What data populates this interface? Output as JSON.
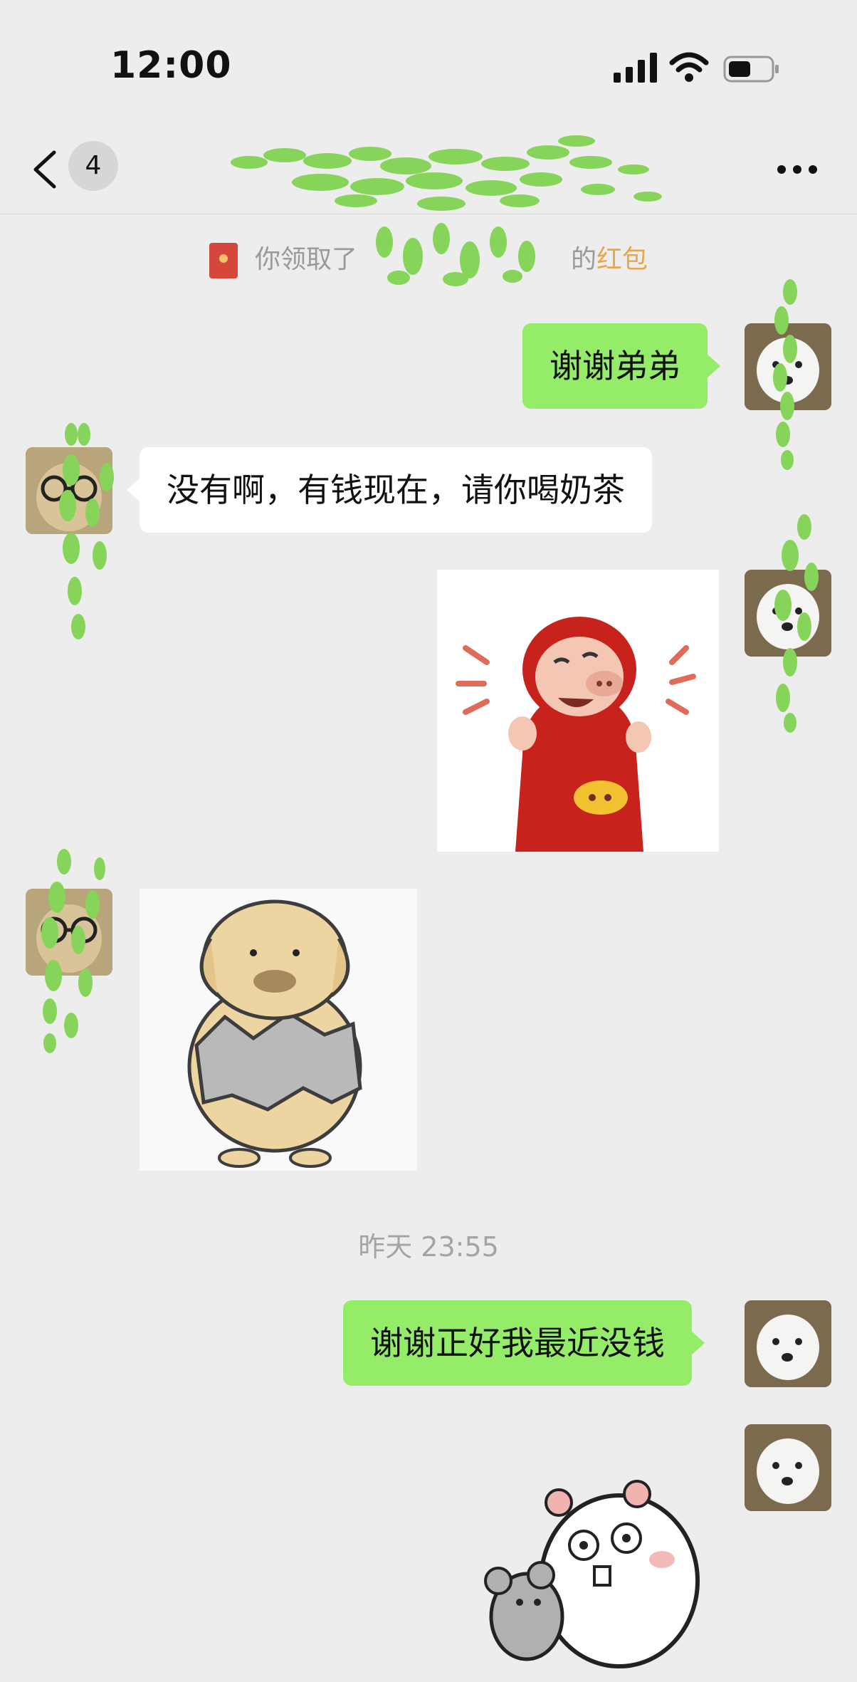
{
  "status_bar": {
    "time": "12:00"
  },
  "nav": {
    "unread_count": "4",
    "title": ""
  },
  "notice": {
    "prefix": "你领取了",
    "suffix": "的",
    "link": "红包"
  },
  "messages": {
    "m1": "谢谢弟弟",
    "m2": "没有啊，有钱现在，请你喝奶茶",
    "m3": "谢谢正好我最近没钱"
  },
  "timestamp": "昨天 23:55",
  "colors": {
    "accent_green": "#95ec69",
    "background": "#ededed",
    "red_packet": "#d5473a",
    "link": "#e5a74a"
  },
  "icons": [
    "back-chevron-icon",
    "more-dots-icon",
    "signal-icon",
    "wifi-icon",
    "battery-icon",
    "red-packet-icon"
  ]
}
